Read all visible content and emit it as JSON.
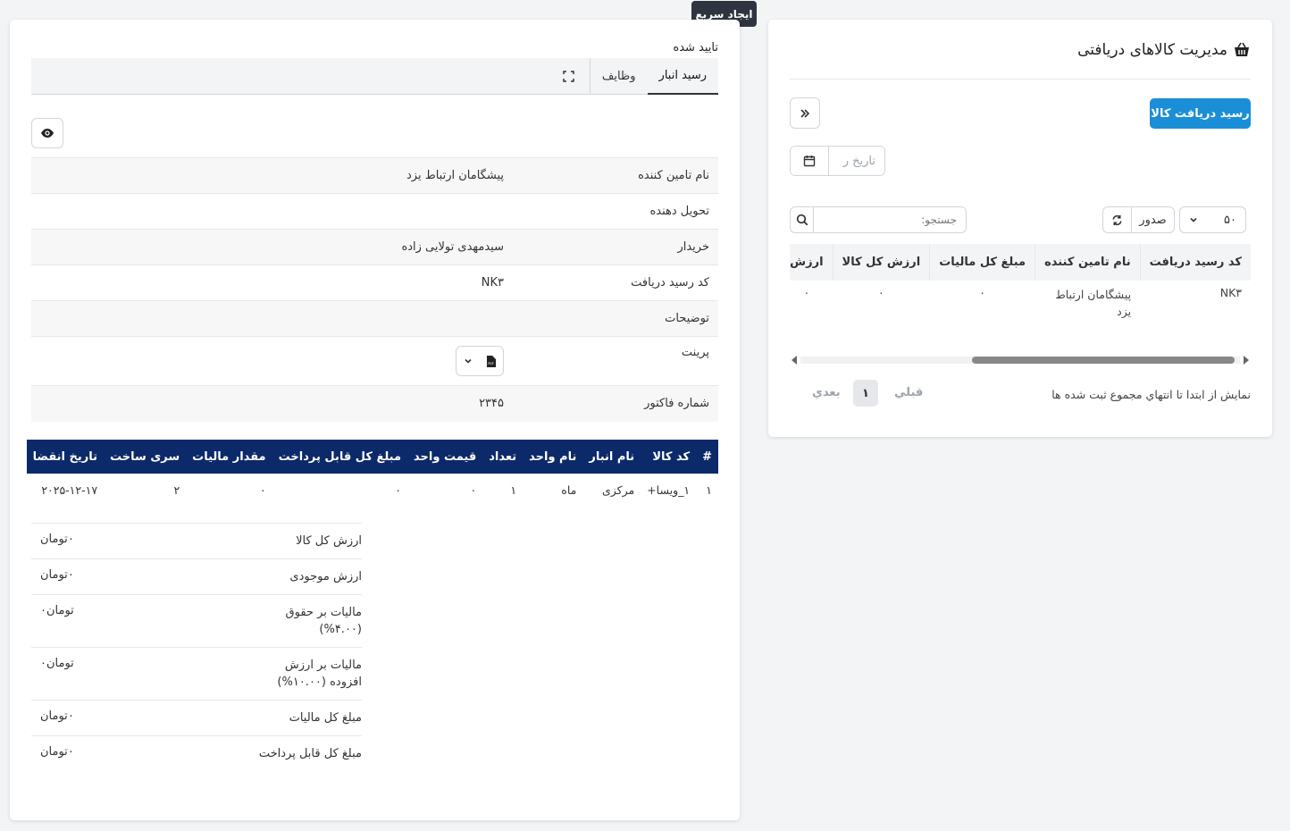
{
  "quick_create": "ایجاد سریع",
  "receipts_panel": {
    "title": "مدیریت کالاهای دریافتی",
    "new_receipt_button": "رسید دریافت کالا",
    "date_placeholder": "تاریخ ر",
    "per_page": "۵۰",
    "export_label": "صدور",
    "search_placeholder": "جستجو:",
    "columns": [
      "کد رسید دریافت",
      "نام تامین کننده",
      "مبلغ کل مالیات",
      "ارزش کل کالا",
      "ارزش"
    ],
    "rows": [
      {
        "code": "NK۳",
        "supplier": "پیشگامان ارتباط یزد",
        "total_tax": "۰",
        "total_value": "۰",
        "value": "۰"
      }
    ],
    "pagination": {
      "info": "نمایش از ابتدا تا انتهاي مجموع ثبت شده ها",
      "prev": "قبلي",
      "current": "۱",
      "next": "بعدي"
    }
  },
  "detail_panel": {
    "status": "تایید شده",
    "tabs": [
      "رسید انبار",
      "وظایف"
    ],
    "fields": [
      {
        "label": "نام تامین کننده",
        "value": "پیشگامان ارتباط یزد"
      },
      {
        "label": "تحویل دهنده",
        "value": ""
      },
      {
        "label": "خریدار",
        "value": "سیدمهدی تولایی زاده"
      },
      {
        "label": "کد رسید دریافت",
        "value": "NK۳"
      },
      {
        "label": "توضیحات",
        "value": ""
      },
      {
        "label": "پرینت",
        "value": ""
      },
      {
        "label": "شماره فاکتور",
        "value": "۲۳۴۵"
      }
    ],
    "items_columns": [
      "#",
      "کد کالا",
      "نام انبار",
      "نام واحد",
      "تعداد",
      "قیمت واحد",
      "مبلغ کل قابل پرداخت",
      "مقدار مالیات",
      "سری ساخت",
      "تاریخ انقضا"
    ],
    "items": [
      [
        "۱",
        "۱_ویسا+",
        "مرکزی",
        "ماه",
        "۱",
        "۰",
        "۰",
        "۰",
        "۲",
        "۲۰۲۵-۱۲-۱۷"
      ]
    ],
    "totals": [
      {
        "label": "ارزش کل کالا",
        "value": "۰تومان"
      },
      {
        "label": "ارزش موجودی",
        "value": "۰تومان"
      },
      {
        "label": "مالیات بر حقوق (۴.۰۰%)",
        "value": "تومان۰"
      },
      {
        "label": "مالیات بر ارزش افزوده (۱۰.۰۰%)",
        "value": "تومان۰"
      },
      {
        "label": "مبلغ کل مالیات",
        "value": "۰تومان"
      },
      {
        "label": "مبلغ کل قابل پرداخت",
        "value": "۰تومان"
      }
    ]
  }
}
